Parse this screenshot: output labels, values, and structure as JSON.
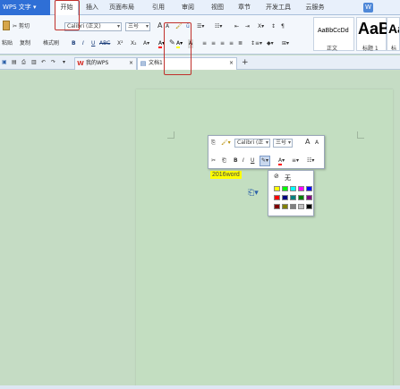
{
  "app": {
    "logo_label": "WPS 文字 ▾"
  },
  "menu": {
    "tabs": [
      "开始",
      "插入",
      "页面布局",
      "引用",
      "审阅",
      "视图",
      "章节",
      "开发工具",
      "云服务"
    ],
    "active_tab": "开始"
  },
  "ribbon": {
    "cut_label": "剪切",
    "paste_label": "粘贴",
    "copy_label": "复制",
    "format_painter_label": "格式刷",
    "font_name": "Calibri (正文)",
    "font_size": "三号",
    "grow_font": "A",
    "shrink_font": "A",
    "bold": "B",
    "italic": "I",
    "underline": "U",
    "strike": "ABC",
    "superscript": "X²",
    "subscript": "X₂",
    "font_color_letter": "A",
    "highlight_letter": "A",
    "char_border_letter": "A",
    "styles": [
      {
        "sample": "AaBbCcDd",
        "name": "正文"
      },
      {
        "sample": "AaBl",
        "name": "标题 1"
      },
      {
        "sample": "AaBb",
        "name": "标"
      }
    ]
  },
  "tabs": [
    {
      "label": "我的WPS",
      "close": "×"
    },
    {
      "label": "文档1",
      "close": "×"
    }
  ],
  "new_tab": "+",
  "document": {
    "selected_text": "2016word"
  },
  "mini_toolbar": {
    "font_name": "Calibri (正",
    "font_size": "三号",
    "grow": "A",
    "shrink": "A",
    "bold": "B",
    "italic": "I",
    "underline": "U"
  },
  "highlight_palette": {
    "none_label": "无",
    "colors": [
      "#ffff00",
      "#00ff00",
      "#00ffff",
      "#ff00ff",
      "#0000ff",
      "#ff0000",
      "#000080",
      "#008080",
      "#008000",
      "#800080",
      "#800000",
      "#808000",
      "#808080",
      "#c0c0c0",
      "#000000"
    ]
  },
  "accent_colors": {
    "highlight": "#ffff00",
    "annotation": "#c0302b",
    "brand": "#2f6fd6"
  }
}
